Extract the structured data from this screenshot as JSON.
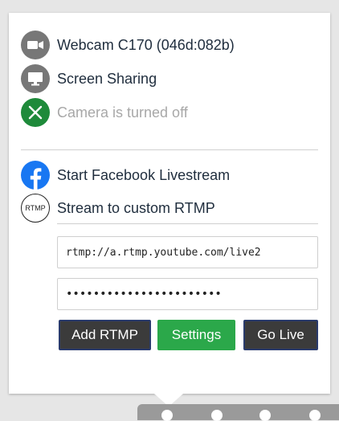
{
  "devices": {
    "webcam_label": "Webcam C170 (046d:082b)",
    "screen_label": "Screen Sharing",
    "camera_status_label": "Camera is turned off"
  },
  "streaming": {
    "facebook_label": "Start Facebook Livestream",
    "rtmp_label": "Stream to custom RTMP",
    "rtmp_icon_text": "RTMP",
    "rtmp_url": "rtmp://a.rtmp.youtube.com/live2",
    "stream_key_masked": "•••••••••••••••••••••••"
  },
  "buttons": {
    "add_rtmp": "Add RTMP",
    "settings": "Settings",
    "go_live": "Go Live"
  },
  "icons": {
    "webcam": "video-camera-icon",
    "screen": "monitor-icon",
    "camera_off": "close-icon",
    "facebook": "facebook-icon",
    "rtmp": "rtmp-icon"
  },
  "colors": {
    "gray_icon": "#777777",
    "green_icon": "#1e8a3a",
    "facebook_blue": "#1877f2",
    "settings_green": "#2ba84a",
    "dark_button": "#3b3b3b"
  }
}
